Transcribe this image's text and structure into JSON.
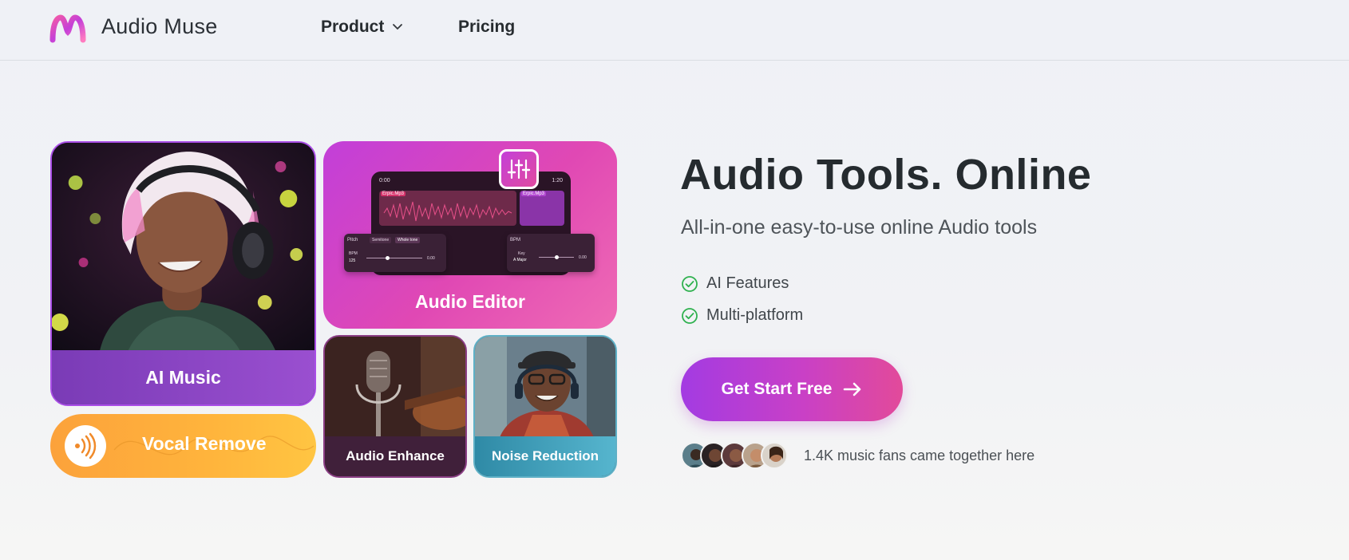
{
  "header": {
    "brand": "Audio Muse",
    "nav": {
      "product": "Product",
      "pricing": "Pricing"
    },
    "logo_icon": "wave-m-logo"
  },
  "tool_cards": {
    "ai_music": "AI Music",
    "vocal_remove": "Vocal Remove",
    "audio_editor": "Audio Editor",
    "audio_enhance": "Audio Enhance",
    "noise_reduction": "Noise Reduction"
  },
  "editor_mockup": {
    "time_start": "0:00",
    "time_end": "1:20",
    "clip_a": "Erpic.Mp3",
    "clip_b": "Erpic.Mp3",
    "pitch_label": "Pitch",
    "semitone": "Semitone",
    "whole_tone": "Whole tone",
    "bpm_label": "BPM",
    "bpm_value": "125",
    "slider_value_a": "0.00",
    "key_label": "Key",
    "key_value": "A Major",
    "slider_value_b": "0.00"
  },
  "hero": {
    "title": "Audio Tools. Online",
    "subtitle": "All-in-one easy-to-use online Audio tools",
    "features": [
      "AI Features",
      "Multi-platform"
    ],
    "cta": "Get Start Free",
    "fans_text": "1.4K music fans came together here"
  },
  "colors": {
    "accent_purple": "#a33be2",
    "accent_pink": "#e24a9a",
    "check_green": "#2fb14f"
  }
}
